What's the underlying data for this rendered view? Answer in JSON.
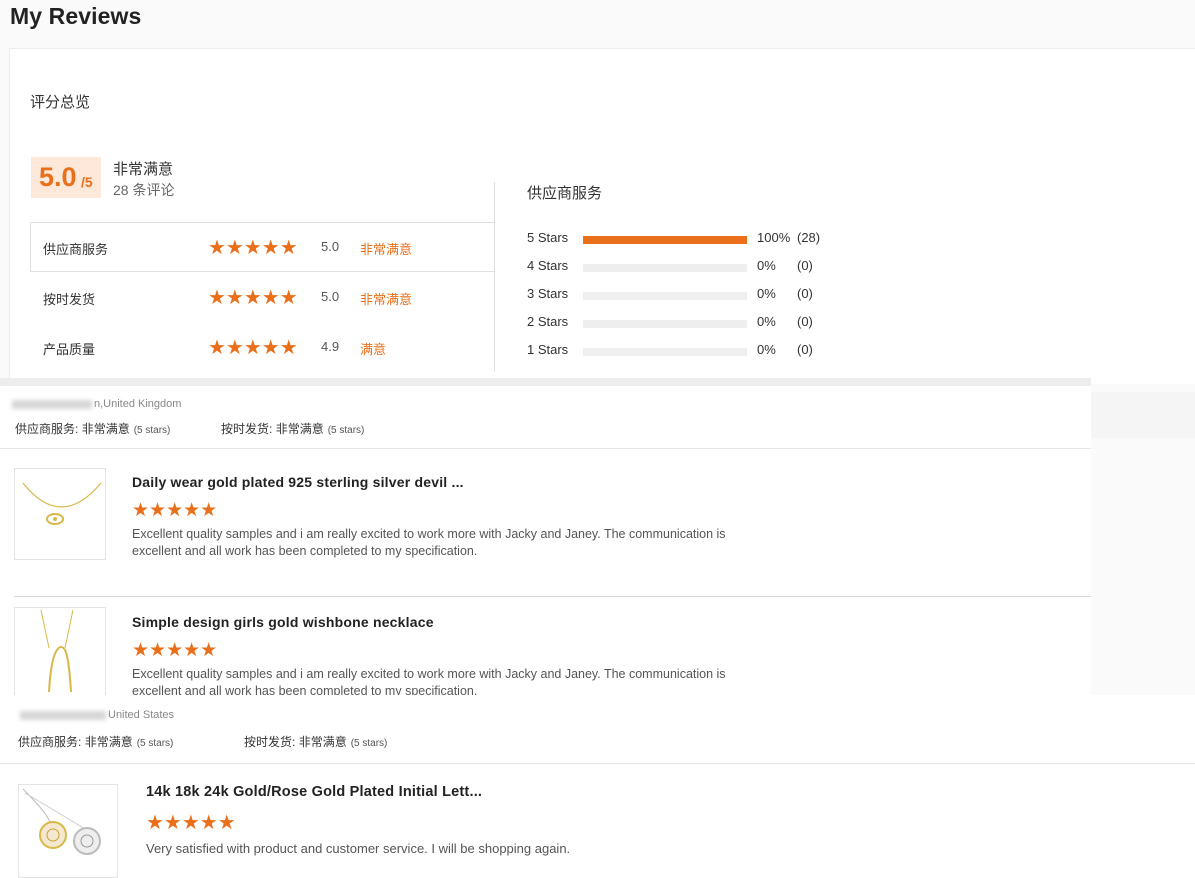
{
  "page_title": "My Reviews",
  "summary": {
    "heading": "评分总览",
    "score": "5.0",
    "score_of": "/5",
    "overall_label": "非常满意",
    "review_count": "28 条评论",
    "metrics": [
      {
        "label": "供应商服务",
        "stars": "★★★★★",
        "score": "5.0",
        "level": "非常满意"
      },
      {
        "label": "按时发货",
        "stars": "★★★★★",
        "score": "5.0",
        "level": "非常满意"
      },
      {
        "label": "产品质量",
        "stars": "★★★★★",
        "score": "4.9",
        "level": "满意"
      }
    ],
    "distribution": {
      "title": "供应商服务",
      "rows": [
        {
          "label": "5  Stars",
          "percent": "100%",
          "count": "(28)",
          "fraction": 1.0
        },
        {
          "label": "4  Stars",
          "percent": "0%",
          "count": "(0)",
          "fraction": 0
        },
        {
          "label": "3  Stars",
          "percent": "0%",
          "count": "(0)",
          "fraction": 0
        },
        {
          "label": "2  Stars",
          "percent": "0%",
          "count": "(0)",
          "fraction": 0
        },
        {
          "label": "1  Stars",
          "percent": "0%",
          "count": "(0)",
          "fraction": 0
        }
      ]
    }
  },
  "reviews": [
    {
      "location": "n,United Kingdom",
      "supplier_label": "供应商服务:",
      "supplier_value": "非常满意",
      "supplier_stars": "(5 stars)",
      "shipping_label": "按时发货:",
      "shipping_value": "非常满意",
      "shipping_stars": "(5 stars)",
      "items": [
        {
          "title": "Daily wear gold plated 925 sterling silver devil ...",
          "stars": "★★★★★",
          "text": "Excellent quality samples and i am really excited to work more with Jacky and Janey. The communication is excellent and all work has been completed to my specification."
        },
        {
          "title": "Simple design girls gold wishbone necklace",
          "stars": "★★★★★",
          "text": "Excellent quality samples and i am really excited to work more with Jacky and Janey. The communication is excellent and all work has been completed to my specification."
        }
      ]
    },
    {
      "location": "United States",
      "supplier_label": "供应商服务:",
      "supplier_value": "非常满意",
      "supplier_stars": "(5 stars)",
      "shipping_label": "按时发货:",
      "shipping_value": "非常满意",
      "shipping_stars": "(5 stars)",
      "items": [
        {
          "title": "14k 18k 24k Gold/Rose Gold Plated Initial Lett...",
          "stars": "★★★★★",
          "text": "Very satisfied with product and customer service. I will be shopping again."
        }
      ]
    }
  ],
  "colors": {
    "accent": "#e96f1a",
    "accent_bg": "#fde8d9"
  }
}
